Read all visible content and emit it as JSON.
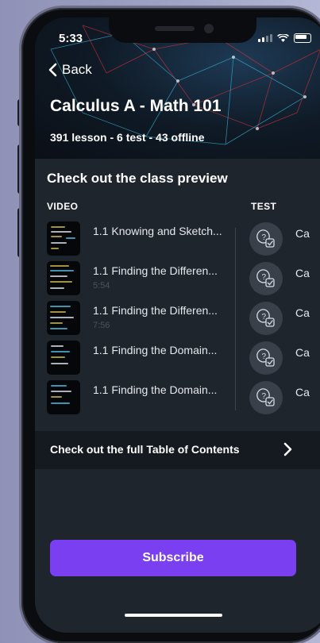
{
  "status": {
    "time": "5:33"
  },
  "nav": {
    "back_label": "Back"
  },
  "course": {
    "title": "Calculus A - Math 101",
    "summary": "391 lesson - 6 test - 43 offline"
  },
  "preview": {
    "heading": "Check out the class preview",
    "video_column": "VIDEO",
    "test_column": "TEST",
    "videos": [
      {
        "title": "1.1 Knowing and Sketch...",
        "duration": ""
      },
      {
        "title": "1.1 Finding the Differen...",
        "duration": "5:54"
      },
      {
        "title": "1.1 Finding the Differen...",
        "duration": "7:56"
      },
      {
        "title": "1.1 Finding the Domain...",
        "duration": ""
      },
      {
        "title": "1.1 Finding the Domain...",
        "duration": ""
      }
    ],
    "tests": [
      {
        "label": "Ca"
      },
      {
        "label": "Ca"
      },
      {
        "label": "Ca"
      },
      {
        "label": "Ca"
      },
      {
        "label": "Ca"
      }
    ]
  },
  "toc": {
    "label": "Check out the full Table of Contents"
  },
  "cta": {
    "subscribe_label": "Subscribe"
  },
  "colors": {
    "accent": "#7b3ff2",
    "background": "#1f252d",
    "toc_bar": "#151a20"
  },
  "icons": {
    "back": "chevron-left-icon",
    "test": "quiz-question-check-icon",
    "toc": "chevron-right-icon"
  }
}
